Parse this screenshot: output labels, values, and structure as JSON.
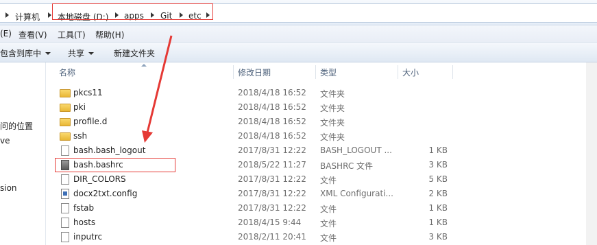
{
  "breadcrumb": [
    "计算机",
    "本地磁盘 (D:)",
    "apps",
    "Git",
    "etc"
  ],
  "menu": [
    "(E)",
    "查看(V)",
    "工具(T)",
    "帮助(H)"
  ],
  "toolbar": {
    "include_library": "包含到库中",
    "share": "共享",
    "new_folder": "新建文件夹"
  },
  "nav": [
    "问的位置",
    "ve",
    "sion"
  ],
  "columns": {
    "name": "名称",
    "modified": "修改日期",
    "type": "类型",
    "size": "大小"
  },
  "files": [
    {
      "name": "pkcs11",
      "date": "2018/4/18 16:52",
      "type": "文件夹",
      "size": "",
      "icon": "folder-icon"
    },
    {
      "name": "pki",
      "date": "2018/4/18 16:52",
      "type": "文件夹",
      "size": "",
      "icon": "folder-icon"
    },
    {
      "name": "profile.d",
      "date": "2018/4/18 16:52",
      "type": "文件夹",
      "size": "",
      "icon": "folder-icon"
    },
    {
      "name": "ssh",
      "date": "2018/4/18 16:52",
      "type": "文件夹",
      "size": "",
      "icon": "folder-icon"
    },
    {
      "name": "bash.bash_logout",
      "date": "2017/8/31 12:22",
      "type": "BASH_LOGOUT ...",
      "size": "1 KB",
      "icon": "file-icon"
    },
    {
      "name": "bash.bashrc",
      "date": "2018/5/22 11:27",
      "type": "BASHRC 文件",
      "size": "3 KB",
      "icon": "system-file-icon"
    },
    {
      "name": "DIR_COLORS",
      "date": "2017/8/31 12:22",
      "type": "文件",
      "size": "5 KB",
      "icon": "file-icon"
    },
    {
      "name": "docx2txt.config",
      "date": "2017/8/31 12:22",
      "type": "XML Configurati...",
      "size": "2 KB",
      "icon": "xml-file-icon"
    },
    {
      "name": "fstab",
      "date": "2017/8/31 12:22",
      "type": "文件",
      "size": "1 KB",
      "icon": "file-icon"
    },
    {
      "name": "hosts",
      "date": "2018/4/15 9:44",
      "type": "文件",
      "size": "1 KB",
      "icon": "file-icon"
    },
    {
      "name": "inputrc",
      "date": "2018/2/11 20:41",
      "type": "文件",
      "size": "3 KB",
      "icon": "file-icon"
    }
  ],
  "annotation_color": "#e53935"
}
